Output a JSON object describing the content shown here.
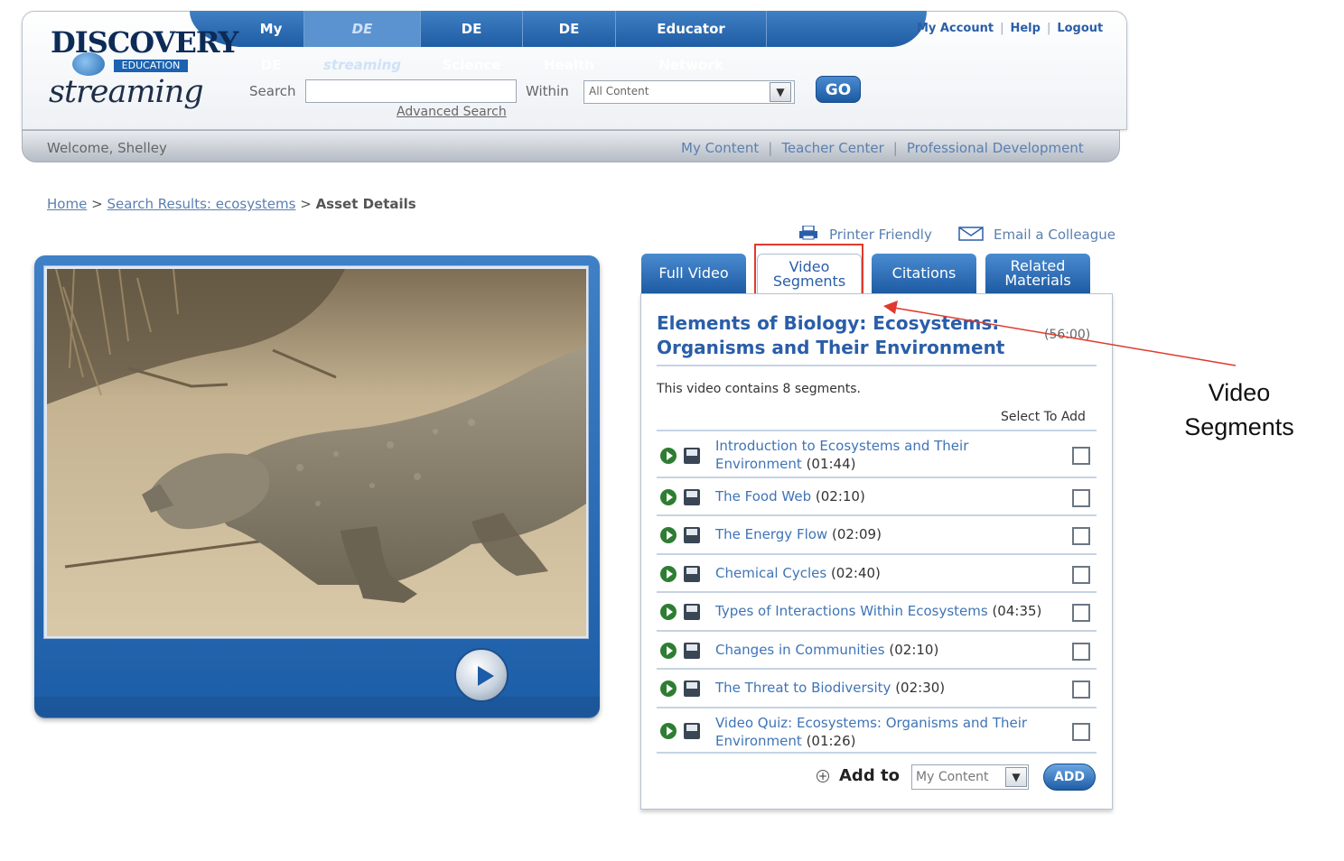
{
  "brand": {
    "discovery": "DISCOVERY",
    "education": "EDUCATION",
    "streaming": "streaming"
  },
  "nav": {
    "items": [
      {
        "label": "My DE"
      },
      {
        "label": "DE streaming"
      },
      {
        "label": "DE Science"
      },
      {
        "label": "DE Health"
      },
      {
        "label": "Educator Network"
      }
    ],
    "active": "DE streaming"
  },
  "account": {
    "my_account": "My Account",
    "help": "Help",
    "logout": "Logout",
    "separator": "|"
  },
  "search": {
    "label": "Search",
    "value": "",
    "within_label": "Within",
    "within_value": "All Content",
    "go_label": "GO",
    "advanced_label": "Advanced Search"
  },
  "status_bar": {
    "welcome": "Welcome, Shelley",
    "links": {
      "my_content": "My Content",
      "teacher_center": "Teacher Center",
      "professional_development": "Professional Development"
    },
    "separator": "|"
  },
  "breadcrumb": {
    "home": "Home",
    "search_results": "Search Results: ecosystems",
    "current": "Asset Details",
    "separator": ">"
  },
  "tools": {
    "printer_friendly": "Printer Friendly",
    "email_colleague": "Email a Colleague"
  },
  "tabs": {
    "full_video": "Full Video",
    "video_segments_1": "Video",
    "video_segments_2": "Segments",
    "citations": "Citations",
    "related_1": "Related",
    "related_2": "Materials"
  },
  "panel": {
    "title": "Elements of Biology: Ecosystems: Organisms and Their Environment",
    "duration": "(56:00)",
    "segment_count": "This video contains 8 segments.",
    "select_to_add": "Select To Add"
  },
  "segments": [
    {
      "title": "Introduction to Ecosystems and Their Environment",
      "duration": "(01:44)",
      "checked": false
    },
    {
      "title": "The Food Web",
      "duration": "(02:10)",
      "checked": false
    },
    {
      "title": "The Energy Flow",
      "duration": "(02:09)",
      "checked": false
    },
    {
      "title": "Chemical Cycles",
      "duration": "(02:40)",
      "checked": false
    },
    {
      "title": "Types of Interactions Within Ecosystems",
      "duration": "(04:35)",
      "checked": false
    },
    {
      "title": "Changes in Communities",
      "duration": "(02:10)",
      "checked": false
    },
    {
      "title": "The Threat to Biodiversity",
      "duration": "(02:30)",
      "checked": false
    },
    {
      "title": "Video Quiz: Ecosystems: Organisms and Their Environment",
      "duration": "(01:26)",
      "checked": false
    }
  ],
  "add_to": {
    "label": "Add to",
    "plus": "+",
    "select_value": "My Content",
    "button": "ADD"
  },
  "annotation": {
    "label_1": "Video",
    "label_2": "Segments",
    "color": "#e03a2e"
  },
  "colors": {
    "brand_blue": "#1f5da4",
    "link_blue": "#2a5ea8",
    "segment_play_green": "#2e7d32"
  }
}
